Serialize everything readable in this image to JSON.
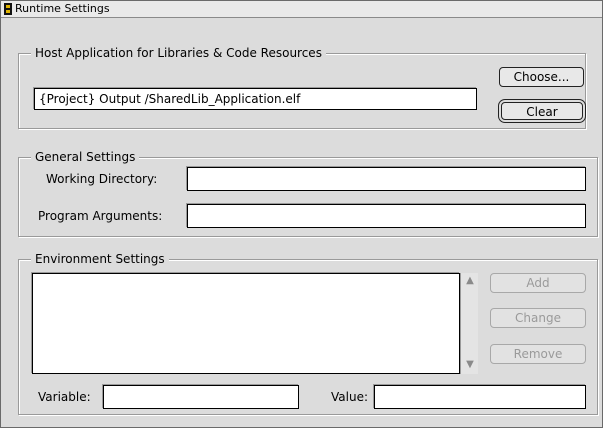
{
  "window": {
    "title": "Runtime Settings"
  },
  "host_app": {
    "legend": "Host Application for Libraries & Code Resources",
    "path_value": "{Project} Output /SharedLib_Application.elf",
    "choose_label": "Choose...",
    "clear_label": "Clear"
  },
  "general": {
    "legend": "General Settings",
    "working_dir_label": "Working Directory:",
    "working_dir_value": "",
    "program_args_label": "Program Arguments:",
    "program_args_value": ""
  },
  "env": {
    "legend": "Environment Settings",
    "add_label": "Add",
    "change_label": "Change",
    "remove_label": "Remove",
    "variable_label": "Variable:",
    "variable_value": "",
    "value_label": "Value:",
    "value_value": "",
    "scroll_up_icon": "scroll-up-arrow",
    "scroll_down_icon": "scroll-down-arrow"
  }
}
